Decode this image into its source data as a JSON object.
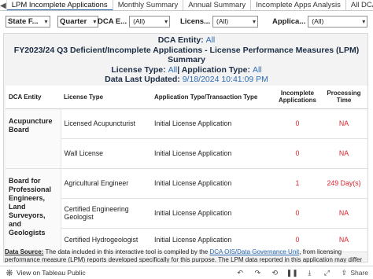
{
  "tabs": {
    "prev_arrow": "◀",
    "items": [
      "LPM Incomplete Applications",
      "Monthly Summary",
      "Annual Summary",
      "Incomplete Apps Analysis",
      "All DCA Entit"
    ]
  },
  "filters": {
    "state_label": "State F...",
    "quarter_label": "Quarter",
    "dca_label": "DCA E...",
    "dca_value": "(All)",
    "license_label": "Licens...",
    "license_value": "(All)",
    "application_label": "Applica...",
    "application_value": "(All)"
  },
  "header": {
    "dca_entity_label": "DCA Entity:",
    "dca_entity_value": "All",
    "title_line1": "FY2023/24 Q3 Deficient/Incomplete Applications - License Performance Measures (LPM)",
    "title_line2": "Summary",
    "license_type_label": "License Type:",
    "license_type_value": "All",
    "application_type_label": "| Application Type:",
    "application_type_value": "All",
    "last_updated_label": "Data Last Updated:",
    "last_updated_value": "9/18/2024 10:41:09 PM"
  },
  "table": {
    "columns": [
      "DCA Entity",
      "License Type",
      "Application Type/Transaction Type",
      "Incomplete Applications",
      "Processing Time"
    ],
    "groups": [
      {
        "entity": "Acupuncture Board",
        "rows": [
          {
            "license": "Licensed Acupuncturist",
            "app_type": "Initial License Application",
            "incomplete": "0",
            "time": "NA"
          },
          {
            "license": "Wall License",
            "app_type": "Initial License Application",
            "incomplete": "0",
            "time": "NA"
          }
        ]
      },
      {
        "entity": "Board for Professional Engineers, Land Surveyors, and Geologists",
        "rows": [
          {
            "license": "Agricultural Engineer",
            "app_type": "Initial License Application",
            "incomplete": "1",
            "time": "249 Day(s)"
          },
          {
            "license": "Certified Engineering Geologist",
            "app_type": "Initial License Application",
            "incomplete": "0",
            "time": "NA"
          },
          {
            "license": "Certified Hydrogeologist",
            "app_type": "Initial License Application",
            "incomplete": "0",
            "time": "NA"
          }
        ]
      }
    ]
  },
  "footer": {
    "source_label": "Data Source:",
    "text1": " The data included in this interactive tool is compiled by the ",
    "link": "DCA OIS/Data Governance Unit",
    "text2": ", from licensing performance measure (LPM) reports developed specifically for this purpose. The LPM data reported in this application may differ from other LPM"
  },
  "toolbar": {
    "view_on": "View on Tableau Public",
    "share_label": "Share"
  },
  "colors": {
    "accent": "#2f6db5",
    "alert": "#d9232d",
    "title": "#1d2d44"
  }
}
